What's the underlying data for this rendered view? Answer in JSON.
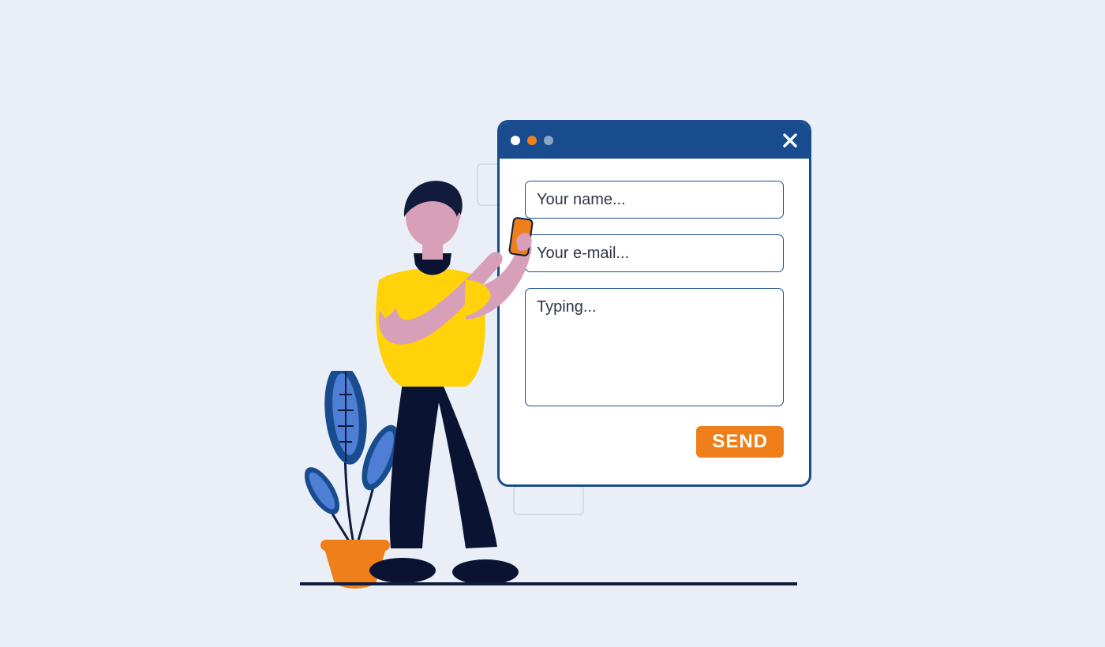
{
  "form": {
    "name_placeholder": "Your name...",
    "email_placeholder": "Your e-mail...",
    "message_placeholder": "Typing...",
    "send_label": "SEND"
  },
  "colors": {
    "accent_blue": "#184c8f",
    "accent_orange": "#ef7f1a",
    "accent_yellow": "#ffd20a",
    "bg": "#eaeff7"
  }
}
